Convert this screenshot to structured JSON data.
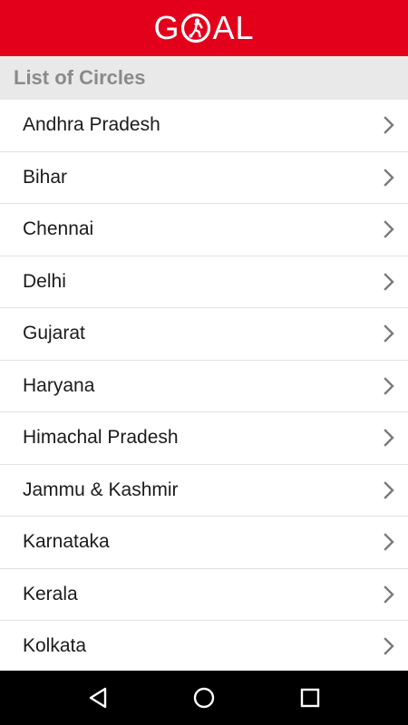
{
  "header": {
    "logo_text_left": "G",
    "logo_text_right": "AL",
    "logo_ball_icon": "football-player-icon",
    "bg_color": "#e3001b"
  },
  "section": {
    "title": "List of Circles"
  },
  "circles": [
    {
      "label": "Andhra Pradesh"
    },
    {
      "label": "Bihar"
    },
    {
      "label": "Chennai"
    },
    {
      "label": "Delhi"
    },
    {
      "label": "Gujarat"
    },
    {
      "label": "Haryana"
    },
    {
      "label": "Himachal Pradesh"
    },
    {
      "label": "Jammu & Kashmir"
    },
    {
      "label": "Karnataka"
    },
    {
      "label": "Kerala"
    },
    {
      "label": "Kolkata"
    }
  ],
  "navbar": {
    "back_icon": "triangle-back-icon",
    "home_icon": "circle-home-icon",
    "recents_icon": "square-recents-icon"
  }
}
